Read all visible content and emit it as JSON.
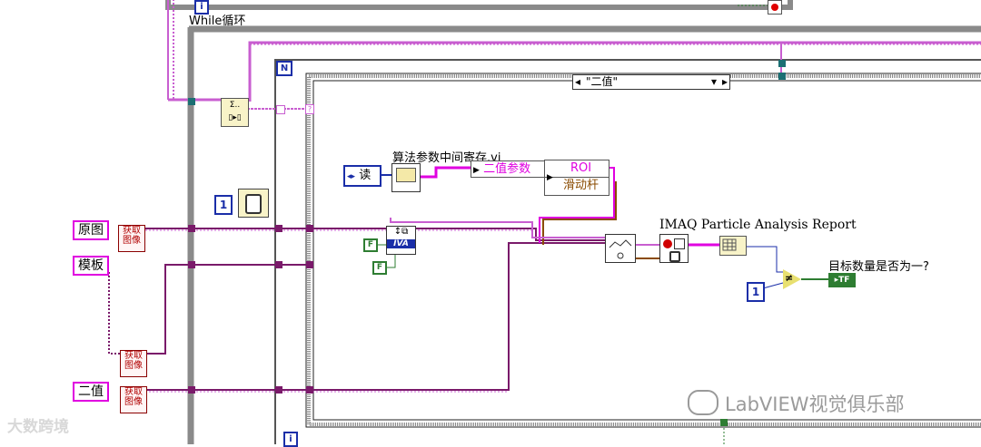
{
  "while_loop": {
    "label": "While循环",
    "info_glyph": "i"
  },
  "for_loop": {
    "count_terminal": "N",
    "info_glyph": "i",
    "bottom_info_glyph": "i"
  },
  "case_selector": {
    "value": "\"二值\"",
    "left_arrow": "◂",
    "right_arrow": "▸",
    "dropdown": "▾"
  },
  "controls": {
    "source_image": "原图",
    "template_image": "模板",
    "binary_image": "二值"
  },
  "subvi_get_image": {
    "line1": "获取",
    "line2": "图像"
  },
  "read_enum": {
    "value": "读",
    "arrows": "◂▸"
  },
  "algo_vi_label": "算法参数中间寄存.vi",
  "bundle": {
    "field1": "二值参数",
    "field2": "ROI",
    "field3": "滑动杆"
  },
  "constants": {
    "one_a": "1",
    "one_b": "1",
    "false_a": "F",
    "false_b": "F",
    "true_indicator": "TF"
  },
  "imaq_label": "IMAQ Particle Analysis Report",
  "result_label": "目标数量是否为一?",
  "ivb_text": "IVA",
  "watermark": {
    "left": "大数跨境",
    "right": "LabVIEW视觉俱乐部"
  }
}
